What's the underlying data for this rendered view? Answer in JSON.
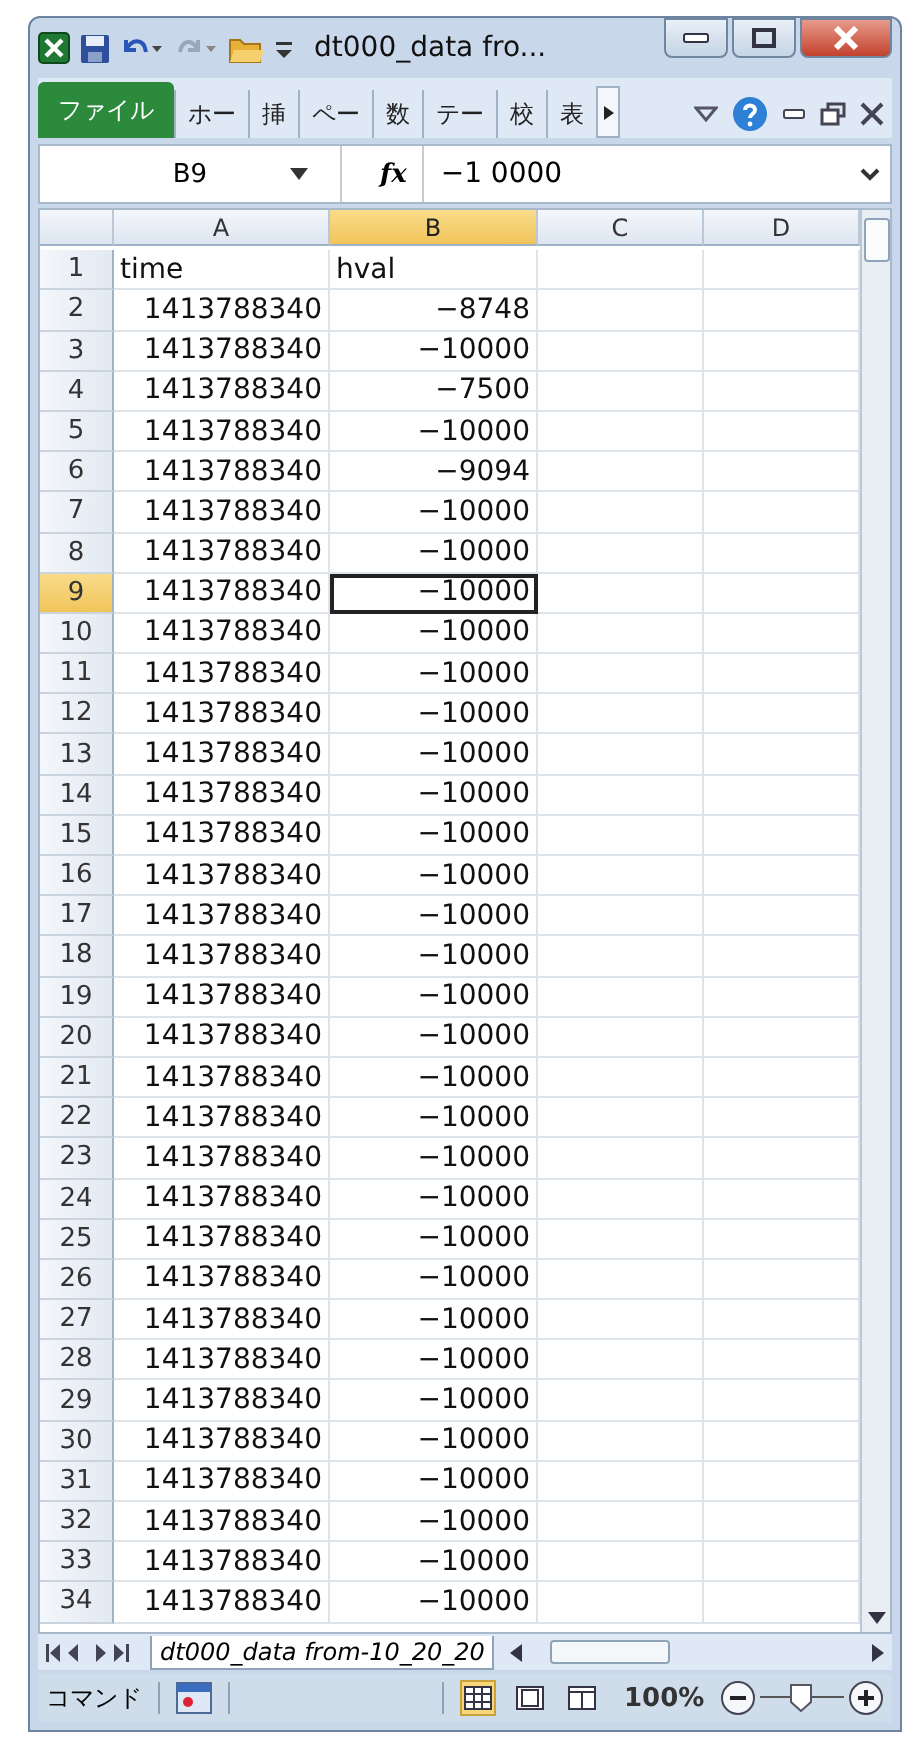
{
  "window": {
    "title": "dt000_data fro..."
  },
  "ribbon_tabs": [
    {
      "label": "ファイル",
      "selected": true
    },
    {
      "label": "ホー",
      "selected": false
    },
    {
      "label": "挿",
      "selected": false
    },
    {
      "label": "ペー",
      "selected": false
    },
    {
      "label": "数",
      "selected": false
    },
    {
      "label": "テー",
      "selected": false
    },
    {
      "label": "校",
      "selected": false
    },
    {
      "label": "表",
      "selected": false
    }
  ],
  "formula_bar": {
    "name_box": "B9",
    "fx": "fx",
    "value": "−1 0000"
  },
  "columns": [
    {
      "label": "A",
      "selected": false
    },
    {
      "label": "B",
      "selected": true
    },
    {
      "label": "C",
      "selected": false
    },
    {
      "label": "D",
      "selected": false
    }
  ],
  "rows": [
    {
      "header": "1",
      "a": "time",
      "b": "hval",
      "selected": false
    },
    {
      "header": "2",
      "a": "1413788340",
      "b": "−8748",
      "selected": false
    },
    {
      "header": "3",
      "a": "1413788340",
      "b": "−10000",
      "selected": false
    },
    {
      "header": "4",
      "a": "1413788340",
      "b": "−7500",
      "selected": false
    },
    {
      "header": "5",
      "a": "1413788340",
      "b": "−10000",
      "selected": false
    },
    {
      "header": "6",
      "a": "1413788340",
      "b": "−9094",
      "selected": false
    },
    {
      "header": "7",
      "a": "1413788340",
      "b": "−10000",
      "selected": false
    },
    {
      "header": "8",
      "a": "1413788340",
      "b": "−10000",
      "selected": false
    },
    {
      "header": "9",
      "a": "1413788340",
      "b": "−10000",
      "selected": true
    },
    {
      "header": "10",
      "a": "1413788340",
      "b": "−10000",
      "selected": false
    },
    {
      "header": "11",
      "a": "1413788340",
      "b": "−10000",
      "selected": false
    },
    {
      "header": "12",
      "a": "1413788340",
      "b": "−10000",
      "selected": false
    },
    {
      "header": "13",
      "a": "1413788340",
      "b": "−10000",
      "selected": false
    },
    {
      "header": "14",
      "a": "1413788340",
      "b": "−10000",
      "selected": false
    },
    {
      "header": "15",
      "a": "1413788340",
      "b": "−10000",
      "selected": false
    },
    {
      "header": "16",
      "a": "1413788340",
      "b": "−10000",
      "selected": false
    },
    {
      "header": "17",
      "a": "1413788340",
      "b": "−10000",
      "selected": false
    },
    {
      "header": "18",
      "a": "1413788340",
      "b": "−10000",
      "selected": false
    },
    {
      "header": "19",
      "a": "1413788340",
      "b": "−10000",
      "selected": false
    },
    {
      "header": "20",
      "a": "1413788340",
      "b": "−10000",
      "selected": false
    },
    {
      "header": "21",
      "a": "1413788340",
      "b": "−10000",
      "selected": false
    },
    {
      "header": "22",
      "a": "1413788340",
      "b": "−10000",
      "selected": false
    },
    {
      "header": "23",
      "a": "1413788340",
      "b": "−10000",
      "selected": false
    },
    {
      "header": "24",
      "a": "1413788340",
      "b": "−10000",
      "selected": false
    },
    {
      "header": "25",
      "a": "1413788340",
      "b": "−10000",
      "selected": false
    },
    {
      "header": "26",
      "a": "1413788340",
      "b": "−10000",
      "selected": false
    },
    {
      "header": "27",
      "a": "1413788340",
      "b": "−10000",
      "selected": false
    },
    {
      "header": "28",
      "a": "1413788340",
      "b": "−10000",
      "selected": false
    },
    {
      "header": "29",
      "a": "1413788340",
      "b": "−10000",
      "selected": false
    },
    {
      "header": "30",
      "a": "1413788340",
      "b": "−10000",
      "selected": false
    },
    {
      "header": "31",
      "a": "1413788340",
      "b": "−10000",
      "selected": false
    },
    {
      "header": "32",
      "a": "1413788340",
      "b": "−10000",
      "selected": false
    },
    {
      "header": "33",
      "a": "1413788340",
      "b": "−10000",
      "selected": false
    },
    {
      "header": "34",
      "a": "1413788340",
      "b": "−10000",
      "selected": false
    }
  ],
  "sheet_tabs": [
    {
      "label": "dt000_data from-10_20_20",
      "selected": true
    }
  ],
  "status_bar": {
    "mode": "コマンド",
    "zoom": "100%",
    "views": [
      {
        "selected": true
      },
      {
        "selected": false
      },
      {
        "selected": false
      }
    ]
  }
}
